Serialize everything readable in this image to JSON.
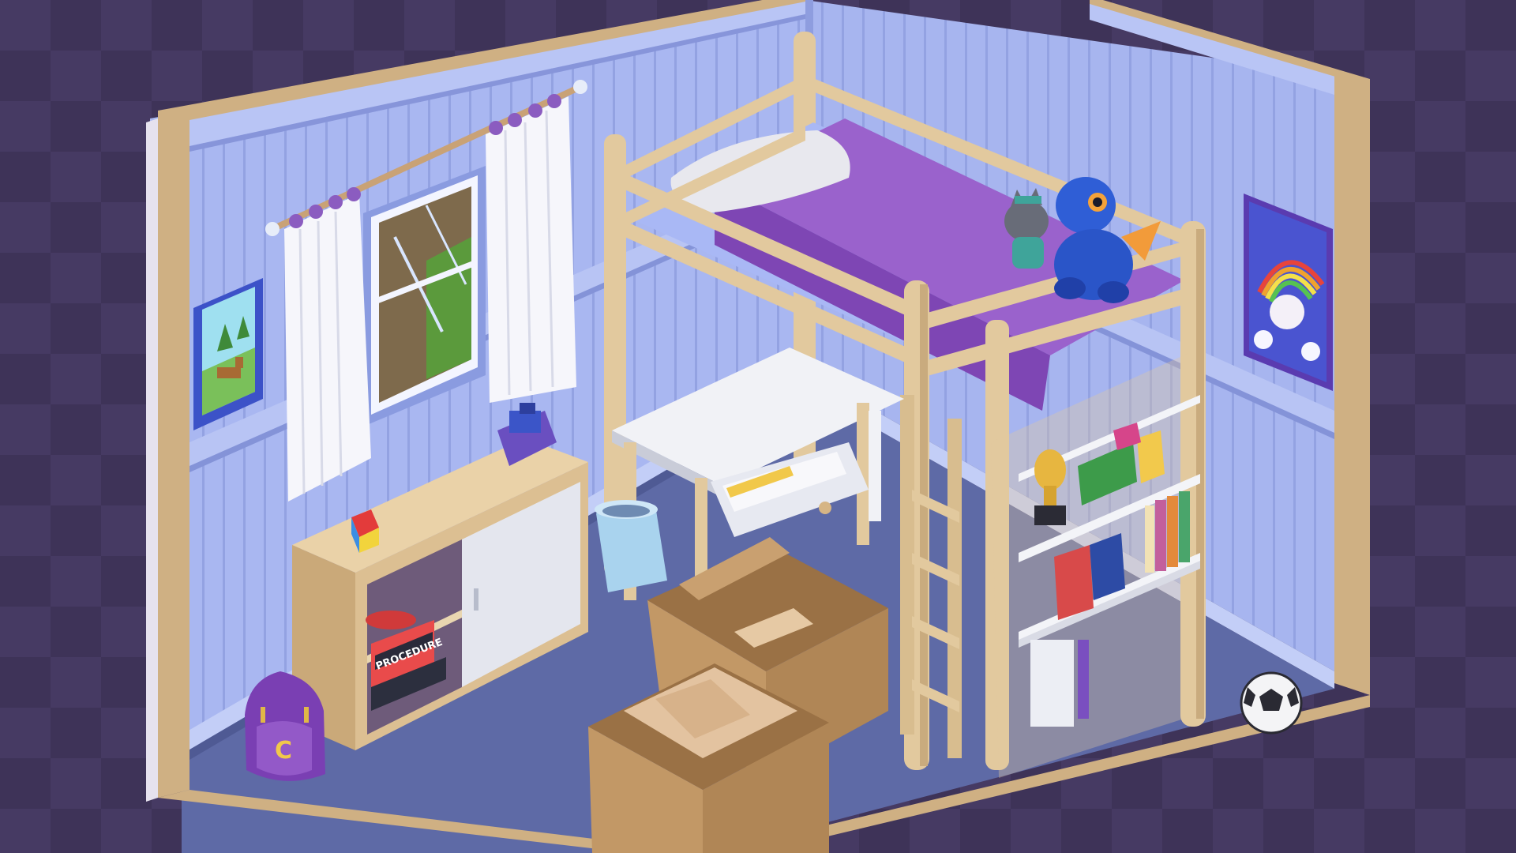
{
  "scene": {
    "title": "",
    "colors": {
      "background": "#3e3358",
      "background_check": "#463a63",
      "wall_left": "#aab8f2",
      "wall_right": "#a7b5ef",
      "wall_stripe": "#8e9de0",
      "floor": "#5e6aa6",
      "wood": "#e2c99e",
      "wood_dark": "#c2a478",
      "bedding": "#9a62cc",
      "cardboard": "#bb9160"
    }
  },
  "game_box": {
    "label": "PROCEDURE"
  },
  "backpack": {
    "emblem": "C"
  }
}
